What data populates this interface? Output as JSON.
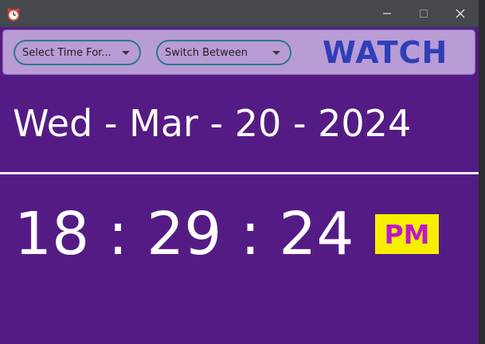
{
  "window": {
    "title": "",
    "controls": {
      "minimize": "–",
      "maximize": "□",
      "close": "✕"
    },
    "app_icon": "alarm-clock-icon"
  },
  "toolbar": {
    "select_time_for": "Select Time For...",
    "switch_between": "Switch Between",
    "brand": "WATCH"
  },
  "clock": {
    "date": "Wed - Mar - 20 - 2024",
    "time": "18 : 29 : 24",
    "ampm": "PM"
  },
  "colors": {
    "background": "#551b85",
    "toolbar": "#b99bd6",
    "brand": "#2e3fb8",
    "ampm_bg": "#f7ef00",
    "ampm_text": "#c018c8"
  }
}
